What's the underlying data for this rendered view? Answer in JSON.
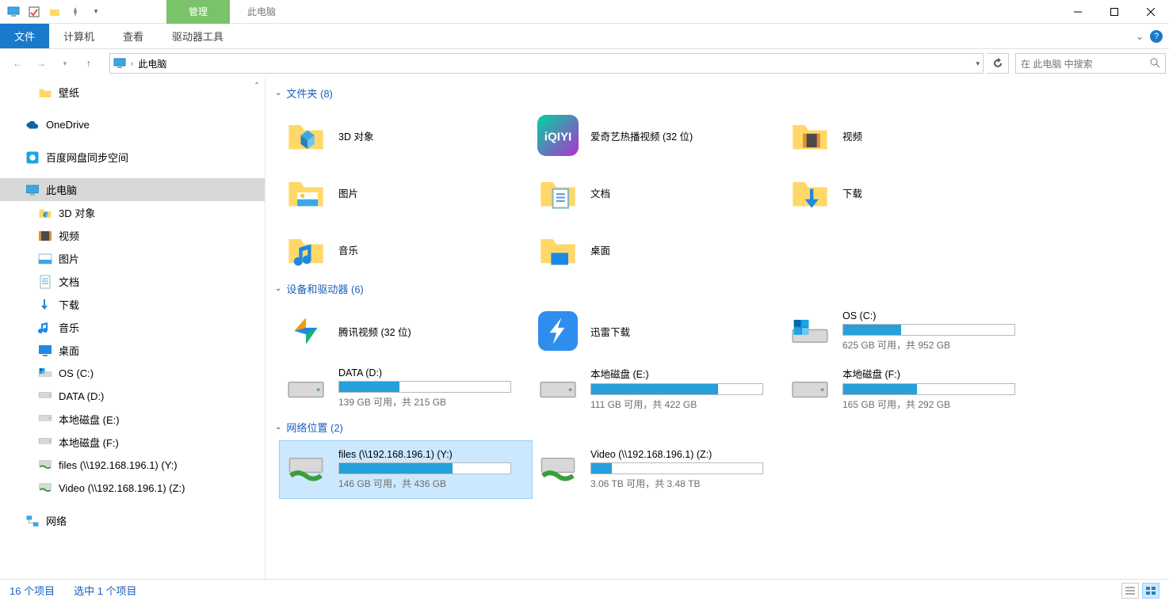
{
  "titlebar": {
    "contextTab": "管理",
    "title": "此电脑"
  },
  "ribbon": {
    "file": "文件",
    "tabs": [
      "计算机",
      "查看",
      "驱动器工具"
    ]
  },
  "address": {
    "text": "此电脑",
    "search_placeholder": "在 此电脑 中搜索"
  },
  "sidebar": [
    {
      "label": "壁纸",
      "icon": "folder",
      "level": 1
    },
    {
      "label": "OneDrive",
      "icon": "onedrive",
      "level": 0
    },
    {
      "label": "百度网盘同步空间",
      "icon": "baidu",
      "level": 0
    },
    {
      "label": "此电脑",
      "icon": "thispc",
      "level": 0,
      "selected": true
    },
    {
      "label": "3D 对象",
      "icon": "3d",
      "level": 1
    },
    {
      "label": "视频",
      "icon": "video",
      "level": 1
    },
    {
      "label": "图片",
      "icon": "pictures",
      "level": 1
    },
    {
      "label": "文档",
      "icon": "docs",
      "level": 1
    },
    {
      "label": "下载",
      "icon": "download",
      "level": 1
    },
    {
      "label": "音乐",
      "icon": "music",
      "level": 1
    },
    {
      "label": "桌面",
      "icon": "desktop",
      "level": 1
    },
    {
      "label": "OS (C:)",
      "icon": "drive-win",
      "level": 1
    },
    {
      "label": "DATA (D:)",
      "icon": "drive",
      "level": 1
    },
    {
      "label": "本地磁盘 (E:)",
      "icon": "drive",
      "level": 1
    },
    {
      "label": "本地磁盘 (F:)",
      "icon": "drive",
      "level": 1
    },
    {
      "label": "files (\\\\192.168.196.1) (Y:)",
      "icon": "netdrive",
      "level": 1
    },
    {
      "label": "Video (\\\\192.168.196.1) (Z:)",
      "icon": "netdrive",
      "level": 1
    },
    {
      "label": "网络",
      "icon": "network",
      "level": 0
    }
  ],
  "groups": {
    "folders": {
      "header": "文件夹 (8)",
      "items": [
        {
          "name": "3D 对象",
          "icon": "3d"
        },
        {
          "name": "爱奇艺热播视频 (32 位)",
          "icon": "iqiyi"
        },
        {
          "name": "视频",
          "icon": "video"
        },
        {
          "name": "图片",
          "icon": "pictures"
        },
        {
          "name": "文档",
          "icon": "docs"
        },
        {
          "name": "下载",
          "icon": "download"
        },
        {
          "name": "音乐",
          "icon": "music"
        },
        {
          "name": "桌面",
          "icon": "desktop"
        }
      ]
    },
    "drives": {
      "header": "设备和驱动器 (6)",
      "items": [
        {
          "name": "腾讯视频 (32 位)",
          "icon": "tencent",
          "type": "app"
        },
        {
          "name": "迅雷下载",
          "icon": "xunlei",
          "type": "app"
        },
        {
          "name": "OS (C:)",
          "icon": "drive-win",
          "type": "drive",
          "sub": "625 GB 可用，共 952 GB",
          "fill": 34
        },
        {
          "name": "DATA (D:)",
          "icon": "drive",
          "type": "drive",
          "sub": "139 GB 可用，共 215 GB",
          "fill": 35
        },
        {
          "name": "本地磁盘 (E:)",
          "icon": "drive",
          "type": "drive",
          "sub": "111 GB 可用，共 422 GB",
          "fill": 74
        },
        {
          "name": "本地磁盘 (F:)",
          "icon": "drive",
          "type": "drive",
          "sub": "165 GB 可用，共 292 GB",
          "fill": 43
        }
      ]
    },
    "network": {
      "header": "网络位置 (2)",
      "items": [
        {
          "name": "files (\\\\192.168.196.1) (Y:)",
          "icon": "netdrive",
          "type": "drive",
          "sub": "146 GB 可用，共 436 GB",
          "fill": 66,
          "selected": true
        },
        {
          "name": "Video (\\\\192.168.196.1) (Z:)",
          "icon": "netdrive",
          "type": "drive",
          "sub": "3.06 TB 可用，共 3.48 TB",
          "fill": 12
        }
      ]
    }
  },
  "status": {
    "count": "16 个项目",
    "selected": "选中 1 个项目"
  }
}
